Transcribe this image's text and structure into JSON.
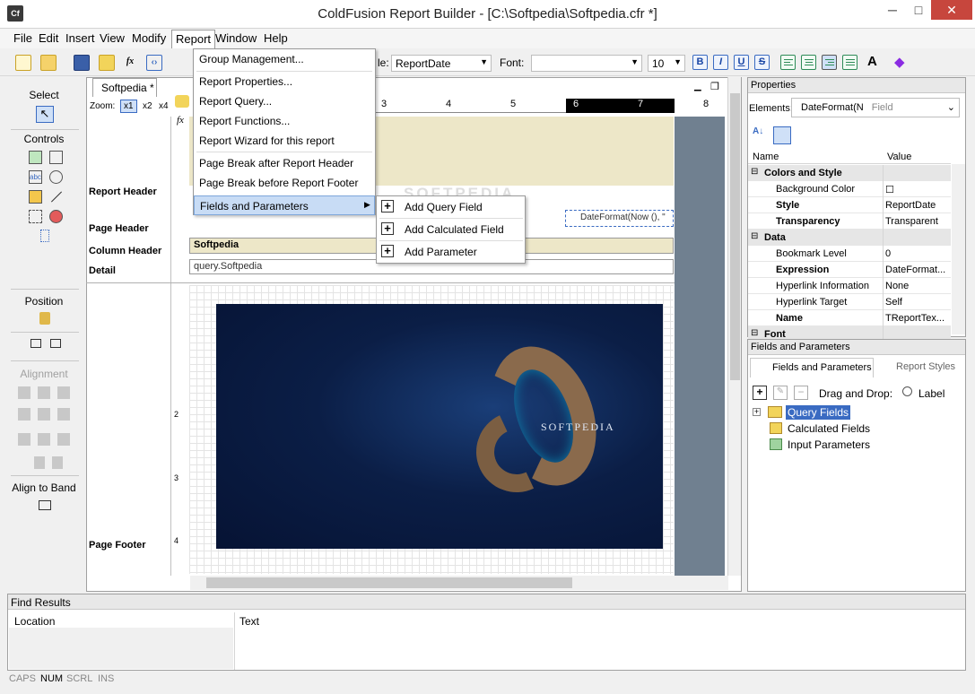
{
  "window": {
    "title": "ColdFusion Report Builder - [C:\\Softpedia\\Softpedia.cfr *]",
    "app_icon": "Cf",
    "minimize": "─",
    "maximize": "□",
    "close": "✕"
  },
  "menubar": {
    "items": [
      "File",
      "Edit",
      "Insert",
      "View",
      "Modify",
      "Report",
      "Window",
      "Help"
    ]
  },
  "report_menu": {
    "items": [
      "Group Management...",
      "Report Properties...",
      "Report Query...",
      "Report Functions...",
      "Report Wizard for this report",
      "Page Break after Report Header",
      "Page Break before Report Footer",
      "Fields and Parameters"
    ]
  },
  "fields_submenu": {
    "items": [
      "Add Query Field",
      "Add Calculated Field",
      "Add Parameter"
    ]
  },
  "toolbar": {
    "style_label": "le:",
    "style_value": "ReportDate",
    "font_label": "Font:",
    "font_value": "",
    "size_value": "10",
    "bold": "B",
    "italic": "I",
    "underline": "U",
    "strike": "S"
  },
  "left_panel": {
    "select": "Select",
    "controls": "Controls",
    "position": "Position",
    "alignment": "Alignment",
    "align_to_band": "Align to Band"
  },
  "document": {
    "tab": "Softpedia *",
    "zoom_label": "Zoom:",
    "zoom_options": [
      "x1",
      "x2",
      "x4"
    ],
    "ruler_ticks": [
      "3",
      "4",
      "5",
      "6",
      "7",
      "8"
    ],
    "bands": [
      "Report Header",
      "Page Header",
      "Column Header",
      "Detail",
      "Page Footer"
    ],
    "column_header_text": "Softpedia",
    "detail_text": "query.Softpedia",
    "date_field": "DateFormat(Now (), \"",
    "vertical_ruler": [
      "2",
      "3",
      "4"
    ],
    "photo_text": "SOFTPEDIA",
    "watermark": "SOFTPEDIA"
  },
  "properties": {
    "title": "Properties",
    "elements_label": "Elements:",
    "elements_value": "DateFormat(N",
    "elements_type": "Field",
    "col_name": "Name",
    "col_value": "Value",
    "rows": [
      {
        "name": "Colors and Style",
        "value": "",
        "cat": true
      },
      {
        "name": "Background Color",
        "value": "☐",
        "bold": false
      },
      {
        "name": "Style",
        "value": "ReportDate",
        "bold": true
      },
      {
        "name": "Transparency",
        "value": "Transparent",
        "bold": true
      },
      {
        "name": "Data",
        "value": "",
        "cat": true
      },
      {
        "name": "Bookmark Level",
        "value": "0",
        "bold": false
      },
      {
        "name": "Expression",
        "value": "DateFormat...",
        "bold": true
      },
      {
        "name": "Hyperlink Information",
        "value": "None",
        "bold": false
      },
      {
        "name": "Hyperlink Target",
        "value": "Self",
        "bold": false
      },
      {
        "name": "Name",
        "value": "TReportTex...",
        "bold": true
      },
      {
        "name": "Font",
        "value": "",
        "cat": true
      }
    ]
  },
  "fields_panel": {
    "title": "Fields and Parameters",
    "tab_fields": "Fields and Parameters",
    "tab_styles": "Report Styles",
    "drag_drop_label": "Drag and Drop:",
    "drag_drop_option": "Label",
    "tree": [
      "Query Fields",
      "Calculated Fields",
      "Input Parameters"
    ]
  },
  "find_results": {
    "title": "Find Results",
    "col_location": "Location",
    "col_text": "Text"
  },
  "statusbar": {
    "items": [
      "CAPS",
      "NUM",
      "SCRL",
      "INS"
    ]
  },
  "colors": {
    "menu_highlight": "#c8dcf5",
    "band_fill": "#ede7c8",
    "close_red": "#c7463d",
    "gray_area": "#708090"
  }
}
